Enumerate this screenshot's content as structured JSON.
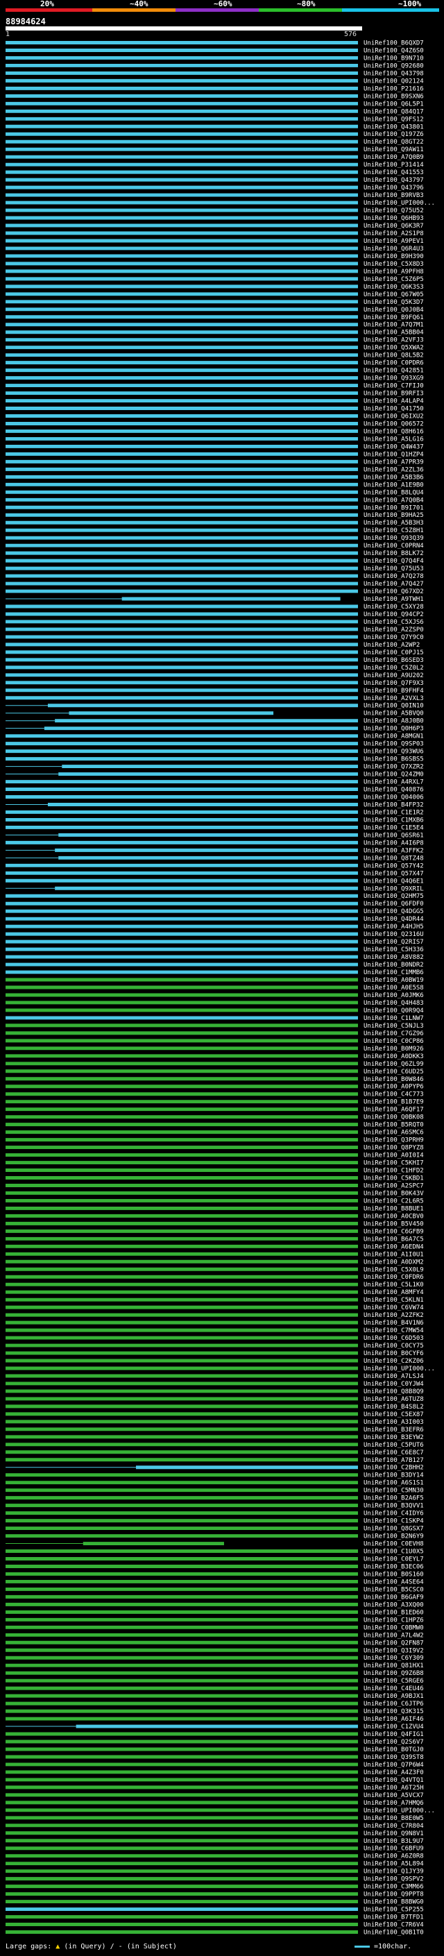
{
  "scale": {
    "labels": [
      "20%",
      "~40%",
      "~60%",
      "~80%",
      "~100%"
    ],
    "colors": [
      "#e01b24",
      "#f28c0a",
      "#8e2fc7",
      "#2bbf2b",
      "#19c2e6"
    ]
  },
  "query": {
    "name": "88984624",
    "start": "1",
    "end": "576"
  },
  "hits": [
    "UniRef100_B6QXD7",
    "UniRef100_Q4Z6S0",
    "UniRef100_B9N710",
    "UniRef100_Q92680",
    "UniRef100_Q43798",
    "UniRef100_Q02124",
    "UniRef100_P21616",
    "UniRef100_B9SXN6",
    "UniRef100_Q6L5P1",
    "UniRef100_Q84Q17",
    "UniRef100_Q9FS12",
    "UniRef100_Q43801",
    "UniRef100_Q197Z6",
    "UniRef100_Q8GT22",
    "UniRef100_Q9AW11",
    "UniRef100_A7Q0B9",
    "UniRef100_P31414",
    "UniRef100_Q41553",
    "UniRef100_Q43797",
    "UniRef100_Q43796",
    "UniRef100_B9RVB3",
    "UniRef100_UPI000...",
    "UniRef100_Q75U52",
    "UniRef100_Q6HB93",
    "UniRef100_Q6K3R7",
    "UniRef100_A2S1P8",
    "UniRef100_A9PEV1",
    "UniRef100_Q6R4U3",
    "UniRef100_B9H390",
    "UniRef100_C5X8D3",
    "UniRef100_A9PFH8",
    "UniRef100_C5Z6P5",
    "UniRef100_Q6K3S3",
    "UniRef100_Q67W05",
    "UniRef100_Q5K3D7",
    "UniRef100_Q0J0B4",
    "UniRef100_B9FQ61",
    "UniRef100_A7Q7M1",
    "UniRef100_A5BB04",
    "UniRef100_A2VFJ3",
    "UniRef100_Q5XWA2",
    "UniRef100_Q8L5B2",
    "UniRef100_C0PDR6",
    "UniRef100_Q42851",
    "UniRef100_Q93XG9",
    "UniRef100_C7FIJ0",
    "UniRef100_B9RFI3",
    "UniRef100_A4LAP4",
    "UniRef100_Q41750",
    "UniRef100_Q6IXU2",
    "UniRef100_Q06572",
    "UniRef100_Q8H616",
    "UniRef100_A5LG16",
    "UniRef100_Q4W437",
    "UniRef100_Q1HZP4",
    "UniRef100_A7PR39",
    "UniRef100_A2ZL36",
    "UniRef100_A5B3B6",
    "UniRef100_A1E9B0",
    "UniRef100_B8LQU4",
    "UniRef100_A7Q0B4",
    "UniRef100_B9I701",
    "UniRef100_B9HA25",
    "UniRef100_A5B3H3",
    "UniRef100_C5Z8H1",
    "UniRef100_Q93Q39",
    "UniRef100_C0PRN4",
    "UniRef100_B8LK72",
    "UniRef100_Q7Q4F4",
    "UniRef100_Q75U53",
    "UniRef100_A7Q278",
    "UniRef100_A7Q427",
    "UniRef100_Q67XD2",
    "UniRef100_A9TWH1",
    "UniRef100_C5XY28",
    "UniRef100_Q94CP2",
    "UniRef100_C5XJS6",
    "UniRef100_A2ZSP0",
    "UniRef100_Q7Y9C0",
    "UniRef100_A2WP2",
    "UniRef100_C0PJ15",
    "UniRef100_B6SED3",
    "UniRef100_C5Z0L2",
    "UniRef100_A9U202",
    "UniRef100_Q7F9X3",
    "UniRef100_B9FHF4",
    "UniRef100_A2VXL3",
    "UniRef100_Q0IN10",
    "UniRef100_A5BVQ0",
    "UniRef100_A8J0B0",
    "UniRef100_Q0H6P3",
    "UniRef100_A8MGN1",
    "UniRef100_Q9SP03",
    "UniRef100_Q93WU6",
    "UniRef100_B6SBS5",
    "UniRef100_Q7XZR2",
    "UniRef100_Q24ZM0",
    "UniRef100_A4RXL7",
    "UniRef100_Q40876",
    "UniRef100_Q04006",
    "UniRef100_B4FP32",
    "UniRef100_C1E1R2",
    "UniRef100_C1MXB6",
    "UniRef100_C1E5E4",
    "UniRef100_Q6SR61",
    "UniRef100_A4I6P8",
    "UniRef100_A3FFK2",
    "UniRef100_Q8TZ48",
    "UniRef100_Q57Y42",
    "UniRef100_Q57X47",
    "UniRef100_Q4Q6E1",
    "UniRef100_Q9XRIL",
    "UniRef100_Q2HM75",
    "UniRef100_Q6FDF0",
    "UniRef100_Q4DGG5",
    "UniRef100_Q4DR44",
    "UniRef100_A4HJH5",
    "UniRef100_Q2316U",
    "UniRef100_Q2RIS7",
    "UniRef100_C5H336",
    "UniRef100_A8V882",
    "UniRef100_B0NDR2",
    "UniRef100_C1MMB6",
    "UniRef100_A0BW19",
    "UniRef100_A0E5S8",
    "UniRef100_A0JMK6",
    "UniRef100_Q4H483",
    "UniRef100_Q0R9Q4",
    "UniRef100_C1LNW7",
    "UniRef100_C5NJL3",
    "UniRef100_C7GZ96",
    "UniRef100_C0CP86",
    "UniRef100_B0M926",
    "UniRef100_A0DKK3",
    "UniRef100_Q6ZL99",
    "UniRef100_C6UD25",
    "UniRef100_B0W846",
    "UniRef100_A0PYP6",
    "UniRef100_C4C773",
    "UniRef100_B1B7E9",
    "UniRef100_A6QF17",
    "UniRef100_Q0BK08",
    "UniRef100_B5RQT0",
    "UniRef100_A6SMC6",
    "UniRef100_Q3PRH9",
    "UniRef100_Q8PYZ8",
    "UniRef100_A0I0I4",
    "UniRef100_C5KHI7",
    "UniRef100_C1HFD2",
    "UniRef100_C5KBD1",
    "UniRef100_A2SPC7",
    "UniRef100_B0K43V",
    "UniRef100_C2L6R5",
    "UniRef100_B8BUE1",
    "UniRef100_A0CBV0",
    "UniRef100_B5V450",
    "UniRef100_C6GFB9",
    "UniRef100_B6A7C5",
    "UniRef100_A6EDN4",
    "UniRef100_A1I0U1",
    "UniRef100_A0DXM2",
    "UniRef100_C5X0L9",
    "UniRef100_C0FDR6",
    "UniRef100_C5L1K0",
    "UniRef100_A8MFY4",
    "UniRef100_C5KLN1",
    "UniRef100_C6VW74",
    "UniRef100_A2ZFK2",
    "UniRef100_B4V1N6",
    "UniRef100_C7MW54",
    "UniRef100_C6D503",
    "UniRef100_C0CY75",
    "UniRef100_B0CYF6",
    "UniRef100_C2KZ06",
    "UniRef100_UPI000...",
    "UniRef100_A7LSJ4",
    "UniRef100_C0YJW4",
    "UniRef100_Q8B8Q9",
    "UniRef100_A6TUZ8",
    "UniRef100_B4S8L2",
    "UniRef100_C5EX87",
    "UniRef100_A3I003",
    "UniRef100_B3EFR6",
    "UniRef100_B3EYW2",
    "UniRef100_C5PUT6",
    "UniRef100_C6E8C7",
    "UniRef100_A7B127",
    "UniRef100_C2BHH2",
    "UniRef100_B3DY14",
    "UniRef100_A6S1S1",
    "UniRef100_C5MN30",
    "UniRef100_B2A6F5",
    "UniRef100_B3QVV1",
    "UniRef100_C4IDY6",
    "UniRef100_C1SKP4",
    "UniRef100_Q8GSX7",
    "UniRef100_B2N6Y9",
    "UniRef100_C0EVH8",
    "UniRef100_C1U0X5",
    "UniRef100_C0EYL7",
    "UniRef100_B3EC06",
    "UniRef100_B0S160",
    "UniRef100_A4SE64",
    "UniRef100_B5CSC0",
    "UniRef100_B6GAF9",
    "UniRef100_A3XQ00",
    "UniRef100_B1ED60",
    "UniRef100_C1HPZ6",
    "UniRef100_C0BMW0",
    "UniRef100_A7L4W2",
    "UniRef100_Q2FN87",
    "UniRef100_Q3I9V2",
    "UniRef100_C6Y309",
    "UniRef100_Q81HX1",
    "UniRef100_Q9Z6B8",
    "UniRef100_C5RGE6",
    "UniRef100_C4EU46",
    "UniRef100_A9BJX1",
    "UniRef100_C6JTP6",
    "UniRef100_Q3K315",
    "UniRef100_A6IF46",
    "UniRef100_C1ZVU4",
    "UniRef100_Q4FIG1",
    "UniRef100_Q2S6V7",
    "UniRef100_B0TGJ0",
    "UniRef100_Q39ST8",
    "UniRef100_Q7P6W4",
    "UniRef100_A4Z3F0",
    "UniRef100_Q4VTQ1",
    "UniRef100_A6T25H",
    "UniRef100_A5VCX7",
    "UniRef100_A7HMQ6",
    "UniRef100_UPI000...",
    "UniRef100_B8E0W5",
    "UniRef100_C7R804",
    "UniRef100_Q9N8V1",
    "UniRef100_B3L9U7",
    "UniRef100_C6BFU9",
    "UniRef100_A6Z0R8",
    "UniRef100_A5L894",
    "UniRef100_Q1JY39",
    "UniRef100_Q9SPV2",
    "UniRef100_C3MM66",
    "UniRef100_Q9PPT8",
    "UniRef100_B8BWG0",
    "UniRef100_C5P255",
    "UniRef100_B7TFD1",
    "UniRef100_C7R6V4",
    "UniRef100_Q0B1T0"
  ],
  "legend": {
    "large_gaps": "Large gaps:",
    "in_query_symbol": "▲",
    "in_query": "(in Query)",
    "divider": "/",
    "in_subject_symbol": "-",
    "in_subject": "(in Subject)",
    "scale_text": "=100char."
  },
  "colors": {
    "cyan": "#4bc8e6",
    "green": "#36b236",
    "dark_gap": "#000000"
  }
}
